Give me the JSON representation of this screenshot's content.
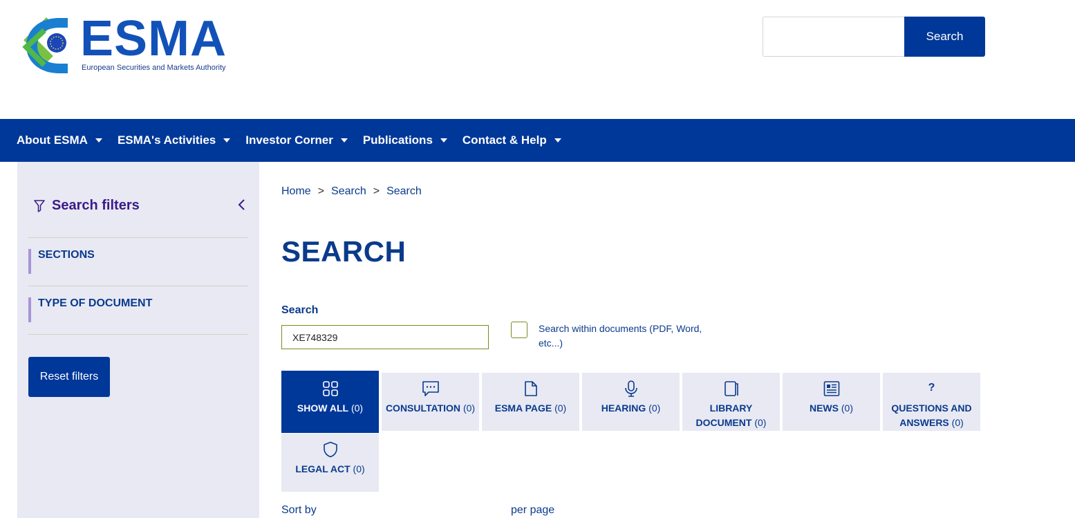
{
  "header": {
    "logo_text": "ESMA",
    "logo_subtitle": "European Securities and Markets Authority",
    "search_placeholder": "",
    "search_button": "Search"
  },
  "nav": {
    "items": [
      {
        "label": "About ESMA"
      },
      {
        "label": "ESMA's Activities"
      },
      {
        "label": "Investor Corner"
      },
      {
        "label": "Publications"
      },
      {
        "label": "Contact & Help"
      }
    ]
  },
  "sidebar": {
    "title": "Search filters",
    "sections": [
      {
        "label": "SECTIONS"
      },
      {
        "label": "TYPE OF DOCUMENT"
      }
    ],
    "reset_button": "Reset filters"
  },
  "breadcrumb": {
    "items": [
      "Home",
      "Search",
      "Search"
    ],
    "separator": ">"
  },
  "main": {
    "title": "SEARCH",
    "search_label": "Search",
    "search_value": "XE748329",
    "within_docs_label": "Search within documents (PDF, Word, etc...)",
    "within_docs_checked": false,
    "tiles": [
      {
        "label": "SHOW ALL",
        "count": "(0)",
        "icon": "grid-icon",
        "active": true
      },
      {
        "label": "CONSULTATION",
        "count": "(0)",
        "icon": "chat-icon",
        "active": false
      },
      {
        "label": "ESMA PAGE",
        "count": "(0)",
        "icon": "page-icon",
        "active": false
      },
      {
        "label": "HEARING",
        "count": "(0)",
        "icon": "microphone-icon",
        "active": false
      },
      {
        "label": "LIBRARY DOCUMENT",
        "count": "(0)",
        "icon": "book-icon",
        "active": false
      },
      {
        "label": "NEWS",
        "count": "(0)",
        "icon": "newspaper-icon",
        "active": false
      },
      {
        "label": "QUESTIONS AND ANSWERS",
        "count": "(0)",
        "icon": "question-icon",
        "active": false
      },
      {
        "label": "LEGAL ACT",
        "count": "(0)",
        "icon": "shield-icon",
        "active": false
      }
    ],
    "sort_by_label": "Sort by",
    "per_page_label": "per page"
  },
  "colors": {
    "brand_blue": "#003899",
    "text_blue": "#0a3a8c",
    "sidebar_bg": "#e8e9f3",
    "filter_title": "#3b1a87",
    "accent_purple": "#a895d8"
  }
}
